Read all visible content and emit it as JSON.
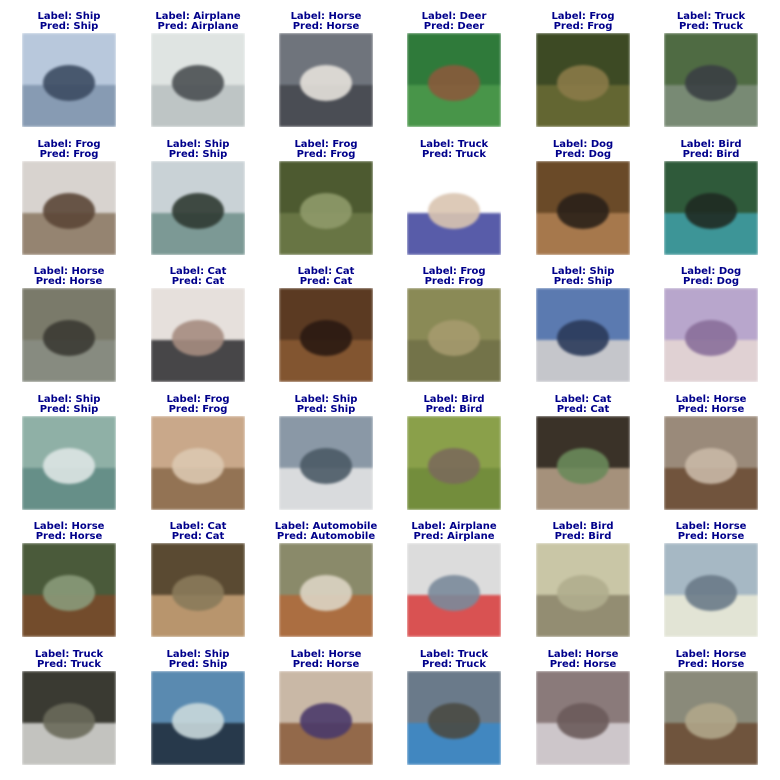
{
  "grid": {
    "label_prefix": "Label: ",
    "pred_prefix": "Pred: ",
    "text_color": "#00008b",
    "items": [
      {
        "label": "Ship",
        "pred": "Ship",
        "thumb": "ship-image",
        "colors": [
          "#b8c8dc",
          "#7e93ab",
          "#3c4b62"
        ]
      },
      {
        "label": "Airplane",
        "pred": "Airplane",
        "thumb": "airplane-image",
        "colors": [
          "#dfe4e2",
          "#b8c0c0",
          "#4a4f52"
        ]
      },
      {
        "label": "Horse",
        "pred": "Horse",
        "thumb": "horse-image",
        "colors": [
          "#6f747c",
          "#44474d",
          "#e6e2dc"
        ]
      },
      {
        "label": "Deer",
        "pred": "Deer",
        "thumb": "deer-image",
        "colors": [
          "#2f7a3a",
          "#4c9a4c",
          "#8a5a3c"
        ]
      },
      {
        "label": "Frog",
        "pred": "Frog",
        "thumb": "frog-image",
        "colors": [
          "#3d4a24",
          "#6a6b35",
          "#8a7a48"
        ]
      },
      {
        "label": "Truck",
        "pred": "Truck",
        "thumb": "truck-image",
        "colors": [
          "#4f6b43",
          "#7f8f7c",
          "#3a3f44"
        ]
      },
      {
        "label": "Frog",
        "pred": "Frog",
        "thumb": "frog-image",
        "colors": [
          "#d8d3cf",
          "#8a7560",
          "#5b4636"
        ]
      },
      {
        "label": "Ship",
        "pred": "Ship",
        "thumb": "ship-image",
        "colors": [
          "#c9d2d6",
          "#6f8f8a",
          "#2f3a32"
        ]
      },
      {
        "label": "Frog",
        "pred": "Frog",
        "thumb": "frog-image",
        "colors": [
          "#4d5a30",
          "#6d7a48",
          "#8f9a6a"
        ]
      },
      {
        "label": "Truck",
        "pred": "Truck",
        "thumb": "truck-image",
        "colors": [
          "#ffffff",
          "#3b3f9a",
          "#d9c4b0"
        ]
      },
      {
        "label": "Dog",
        "pred": "Dog",
        "thumb": "dog-image",
        "colors": [
          "#6a4a28",
          "#b08052",
          "#2a2018"
        ]
      },
      {
        "label": "Bird",
        "pred": "Bird",
        "thumb": "bird-image",
        "colors": [
          "#2f5a3a",
          "#3fa0a8",
          "#1f2a22"
        ]
      },
      {
        "label": "Horse",
        "pred": "Horse",
        "thumb": "horse-image",
        "colors": [
          "#7a7a6a",
          "#8a8e84",
          "#3b3a33"
        ]
      },
      {
        "label": "Cat",
        "pred": "Cat",
        "thumb": "cat-image",
        "colors": [
          "#e6e0dc",
          "#2a2a2e",
          "#a58c80"
        ]
      },
      {
        "label": "Cat",
        "pred": "Cat",
        "thumb": "cat-image",
        "colors": [
          "#5b3a22",
          "#8a5a32",
          "#2a1a12"
        ]
      },
      {
        "label": "Frog",
        "pred": "Frog",
        "thumb": "frog-image",
        "colors": [
          "#8a8a56",
          "#6e6f46",
          "#a59a6e"
        ]
      },
      {
        "label": "Ship",
        "pred": "Ship",
        "thumb": "ship-image",
        "colors": [
          "#5b7ab0",
          "#d8d4d0",
          "#2a3a5a"
        ]
      },
      {
        "label": "Dog",
        "pred": "Dog",
        "thumb": "dog-image",
        "colors": [
          "#b8a6cc",
          "#e6d8d4",
          "#8a6f9a"
        ]
      },
      {
        "label": "Ship",
        "pred": "Ship",
        "thumb": "ship-image",
        "colors": [
          "#8fb0a6",
          "#5f8a82",
          "#dde6e4"
        ]
      },
      {
        "label": "Frog",
        "pred": "Frog",
        "thumb": "frog-image",
        "colors": [
          "#c9a88a",
          "#8a6a4a",
          "#dcc8b0"
        ]
      },
      {
        "label": "Ship",
        "pred": "Ship",
        "thumb": "ship-image",
        "colors": [
          "#8a98a6",
          "#e6e6e6",
          "#4a5a66"
        ]
      },
      {
        "label": "Bird",
        "pred": "Bird",
        "thumb": "bird-image",
        "colors": [
          "#8aa04a",
          "#6f8a3a",
          "#7a6a5a"
        ]
      },
      {
        "label": "Cat",
        "pred": "Cat",
        "thumb": "cat-image",
        "colors": [
          "#3a3228",
          "#b8a28a",
          "#6a8a5a"
        ]
      },
      {
        "label": "Horse",
        "pred": "Horse",
        "thumb": "horse-image",
        "colors": [
          "#9a8a7a",
          "#6a4a32",
          "#c9b8a6"
        ]
      },
      {
        "label": "Horse",
        "pred": "Horse",
        "thumb": "horse-image",
        "colors": [
          "#4a5a3a",
          "#7a4a2a",
          "#8a9a7a"
        ]
      },
      {
        "label": "Cat",
        "pred": "Cat",
        "thumb": "cat-image",
        "colors": [
          "#5a4a32",
          "#c9a278",
          "#8a7a5a"
        ]
      },
      {
        "label": "Automobile",
        "pred": "Automobile",
        "thumb": "automobile-image",
        "colors": [
          "#8a8a6a",
          "#b0683a",
          "#dcd4c4"
        ]
      },
      {
        "label": "Airplane",
        "pred": "Airplane",
        "thumb": "airplane-image",
        "colors": [
          "#dcdcdc",
          "#d83a3a",
          "#7a8a9a"
        ]
      },
      {
        "label": "Bird",
        "pred": "Bird",
        "thumb": "bird-image",
        "colors": [
          "#c9c6a6",
          "#8a8268",
          "#b0ad8e"
        ]
      },
      {
        "label": "Horse",
        "pred": "Horse",
        "thumb": "horse-image",
        "colors": [
          "#a6b8c4",
          "#ecebd8",
          "#6a7a88"
        ]
      },
      {
        "label": "Truck",
        "pred": "Truck",
        "thumb": "truck-image",
        "colors": [
          "#3a3a32",
          "#dcdcd8",
          "#6a6a5a"
        ]
      },
      {
        "label": "Ship",
        "pred": "Ship",
        "thumb": "ship-image",
        "colors": [
          "#5a8ab0",
          "#1f2a3a",
          "#c9d8dc"
        ]
      },
      {
        "label": "Horse",
        "pred": "Horse",
        "thumb": "horse-image",
        "colors": [
          "#c9b8a6",
          "#8a5a3a",
          "#4a3a6a"
        ]
      },
      {
        "label": "Truck",
        "pred": "Truck",
        "thumb": "truck-image",
        "colors": [
          "#6a7a8a",
          "#3a8ac9",
          "#4a4a42"
        ]
      },
      {
        "label": "Horse",
        "pred": "Horse",
        "thumb": "horse-image",
        "colors": [
          "#8a7a7a",
          "#d8d4d8",
          "#6a5a5a"
        ]
      },
      {
        "label": "Horse",
        "pred": "Horse",
        "thumb": "horse-image",
        "colors": [
          "#8a8a7a",
          "#6a4a32",
          "#b0a68a"
        ]
      }
    ]
  }
}
